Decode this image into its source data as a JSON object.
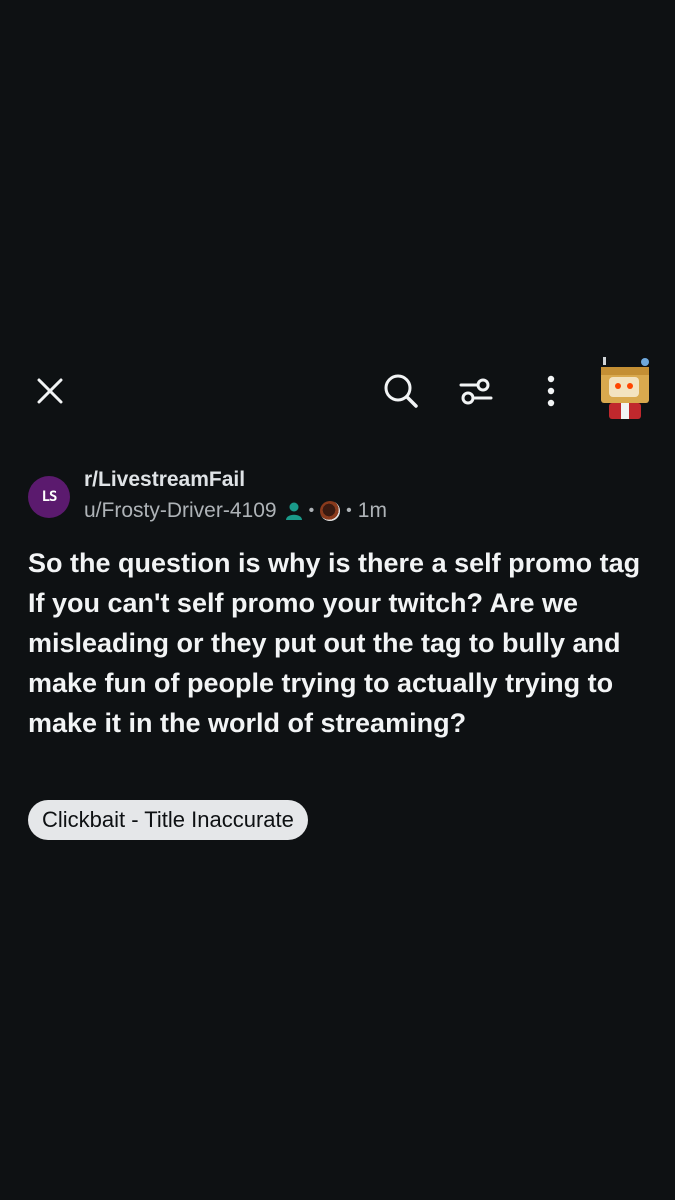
{
  "topbar": {
    "close_icon": "close-icon",
    "search_icon": "search-icon",
    "filter_icon": "filter-icon",
    "more_icon": "more-vertical-icon",
    "avatar": "user-avatar"
  },
  "post": {
    "subreddit": "r/LivestreamFail",
    "subreddit_icon_text": "LS",
    "author": "u/Frosty-Driver-4109",
    "age": "1m",
    "title": "So the question is why is there a self promo tag If you can't self promo your twitch? Are we misleading or they put out the tag to bully and make fun of people trying to actually trying to make it in the world of streaming?",
    "flair": "Clickbait - Title Inaccurate"
  },
  "colors": {
    "background": "#0e1113",
    "text": "#f2f4f5",
    "muted": "#aeb3b7",
    "badge_teal": "#1a9a8a",
    "chip_bg": "#e5e7e9"
  }
}
